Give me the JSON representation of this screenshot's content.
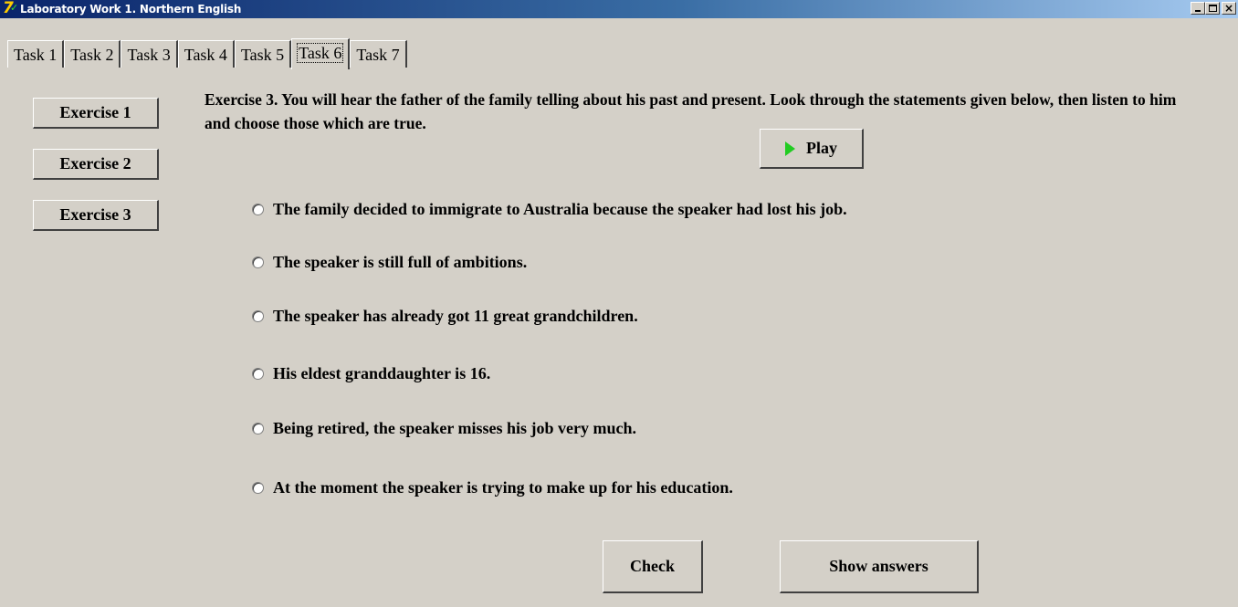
{
  "window": {
    "title": "Laboratory Work 1. Northern English"
  },
  "tabs": [
    {
      "label": "Task 1",
      "active": false
    },
    {
      "label": "Task 2",
      "active": false
    },
    {
      "label": "Task 3",
      "active": false
    },
    {
      "label": "Task 4",
      "active": false
    },
    {
      "label": "Task 5",
      "active": false
    },
    {
      "label": "Task 6",
      "active": true
    },
    {
      "label": "Task 7",
      "active": false
    }
  ],
  "exercises": [
    {
      "label": "Exercise 1"
    },
    {
      "label": "Exercise 2"
    },
    {
      "label": "Exercise 3"
    }
  ],
  "instruction": "Exercise 3. You will hear the father of the family telling about his past and present. Look through the statements given below, then listen to him and choose those which are true.",
  "play": {
    "label": "Play",
    "icon": "play-icon",
    "icon_color": "#22cc22"
  },
  "options": [
    {
      "text": "The family decided to immigrate to Australia because the speaker had lost his job.",
      "selected": false
    },
    {
      "text": "The speaker is still full of ambitions.",
      "selected": false
    },
    {
      "text": "The speaker has already got 11 great grandchildren.",
      "selected": false
    },
    {
      "text": "His eldest granddaughter is 16.",
      "selected": false
    },
    {
      "text": "Being retired, the speaker misses his job very much.",
      "selected": false
    },
    {
      "text": "At the moment the speaker is trying to make up for his education.",
      "selected": false
    }
  ],
  "actions": {
    "check_label": "Check",
    "show_answers_label": "Show answers"
  }
}
